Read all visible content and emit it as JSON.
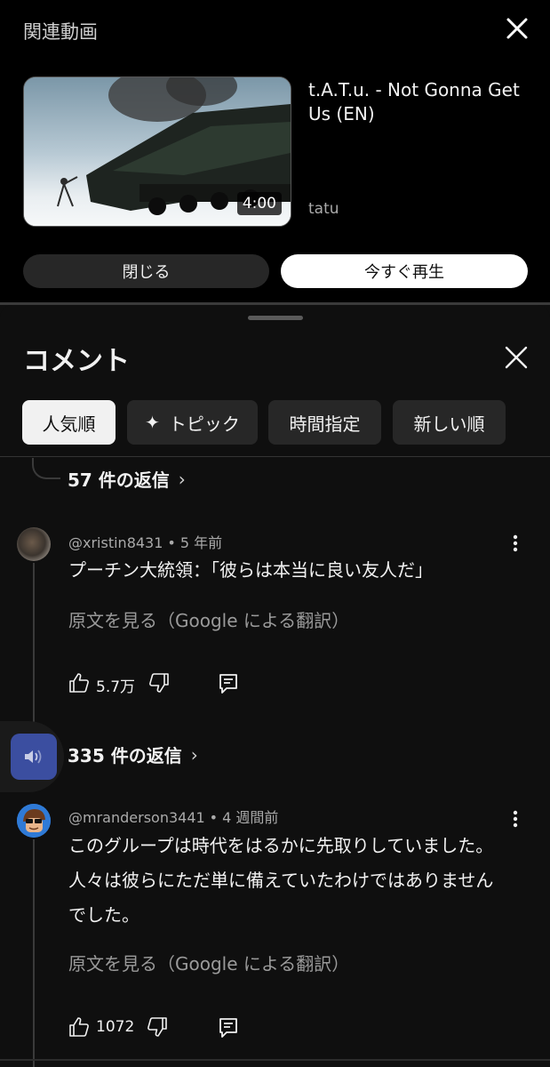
{
  "related": {
    "title": "関連動画",
    "video_title": "t.A.T.u. - Not Gonna Get Us (EN)",
    "channel": "tatu",
    "duration": "4:00",
    "close_button": "閉じる",
    "play_button": "今すぐ再生"
  },
  "comments": {
    "title": "コメント",
    "chips": {
      "popular": "人気順",
      "topic": "トピック",
      "time": "時間指定",
      "newest": "新しい順"
    },
    "prev_replies": "57 件の返信",
    "items": [
      {
        "handle": "@xristin8431",
        "age": "5 年前",
        "text": "プーチン大統領：「彼らは本当に良い友人だ」",
        "translate": "原文を見る（Google による翻訳）",
        "likes": "5.7万",
        "replies": "335 件の返信"
      },
      {
        "handle": "@mranderson3441",
        "age": "4 週間前",
        "text": "このグループは時代をはるかに先取りしていました。人々は彼らにただ単に備えていたわけではありませんでした。",
        "translate": "原文を見る（Google による翻訳）",
        "likes": "1072"
      }
    ],
    "separator": "•",
    "chevron": "›"
  },
  "icons": {
    "close": "close-icon",
    "sparkle": "sparkle-icon",
    "more": "more-vert-icon",
    "like": "thumbs-up-icon",
    "dislike": "thumbs-down-icon",
    "reply": "reply-icon",
    "audio": "volume-icon"
  },
  "colors": {
    "background": "#0f0f0f",
    "chip_active": "#f1f1f1",
    "chip": "#272727",
    "floater": "#3b4ea0"
  }
}
